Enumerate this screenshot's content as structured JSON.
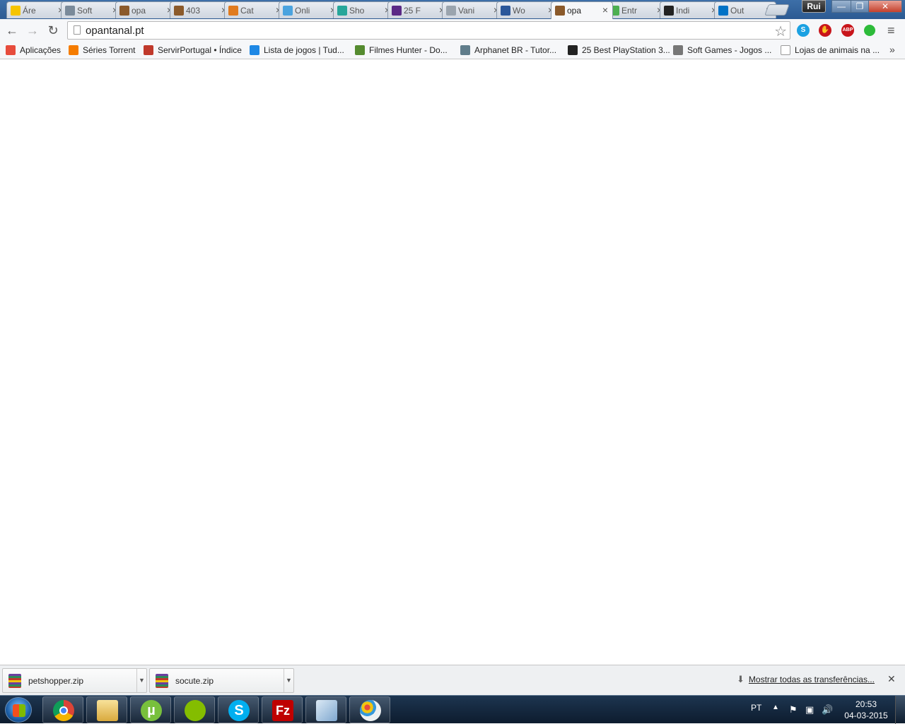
{
  "tabs": [
    {
      "label": "Áre",
      "color": "#f5c400"
    },
    {
      "label": "Soft",
      "color": "#7a8a9a"
    },
    {
      "label": "opa",
      "color": "#8b5a2b"
    },
    {
      "label": "403",
      "color": "#8b5a2b"
    },
    {
      "label": "Cat",
      "color": "#e07b1f"
    },
    {
      "label": "Onli",
      "color": "#4aa3df"
    },
    {
      "label": "Sho",
      "color": "#26a69a"
    },
    {
      "label": "25 F",
      "color": "#5b2a86"
    },
    {
      "label": "Vani",
      "color": "#9aa4ae"
    },
    {
      "label": "Wo",
      "color": "#2b579a"
    },
    {
      "label": "opa",
      "color": "#8b5a2b",
      "active": true
    },
    {
      "label": "Entr",
      "color": "#4caf50"
    },
    {
      "label": "Indi",
      "color": "#222222"
    },
    {
      "label": "Out",
      "color": "#0072c6"
    }
  ],
  "window": {
    "user": "Rui",
    "minimize": "—",
    "maximize": "❐",
    "close": "✕"
  },
  "toolbar": {
    "url": "opantanal.pt"
  },
  "bookmarks": [
    {
      "label": "Aplicações",
      "color": "#e74c3c"
    },
    {
      "label": "Séries Torrent",
      "color": "#f57c00"
    },
    {
      "label": "ServirPortugal • Índice",
      "color": "#c0392b"
    },
    {
      "label": "Lista de jogos | Tud...",
      "color": "#1e88e5"
    },
    {
      "label": "Filmes Hunter - Do...",
      "color": "#558b2f"
    },
    {
      "label": "Arphanet BR - Tutor...",
      "color": "#607d8b"
    },
    {
      "label": "25 Best PlayStation 3...",
      "color": "#222222"
    },
    {
      "label": "Soft Games - Jogos ...",
      "color": "#777777"
    },
    {
      "label": "Lojas de animais na ...",
      "color": "#ffffff"
    }
  ],
  "bookmarks_more": "»",
  "downloads": {
    "items": [
      {
        "name": "petshopper.zip"
      },
      {
        "name": "socute.zip"
      }
    ],
    "show_all": "Mostrar todas as  transferências...",
    "close": "✕"
  },
  "taskbar": {
    "apps": [
      "chrome-icon",
      "explorer-icon",
      "utorrent-icon",
      "spotify-icon",
      "skype-icon",
      "filezilla-icon",
      "app-icon",
      "paint-icon"
    ],
    "language": "PT",
    "time": "20:53",
    "date": "04-03-2015"
  }
}
